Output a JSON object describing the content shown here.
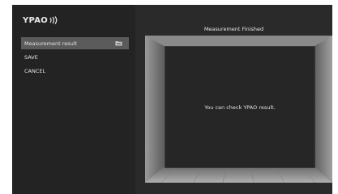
{
  "brand": {
    "logo_text": "YPAO"
  },
  "menu": {
    "items": [
      {
        "label": "Measurement result",
        "selected": true,
        "icon": "folder-icon"
      },
      {
        "label": "SAVE",
        "selected": false
      },
      {
        "label": "CANCEL",
        "selected": false
      }
    ]
  },
  "content": {
    "header": "Measurement Finished",
    "message": "You can check YPAO result."
  },
  "colors": {
    "background": "#1f1f1f",
    "menu_highlight": "#5b5b5b",
    "text": "#e4e4e4"
  }
}
